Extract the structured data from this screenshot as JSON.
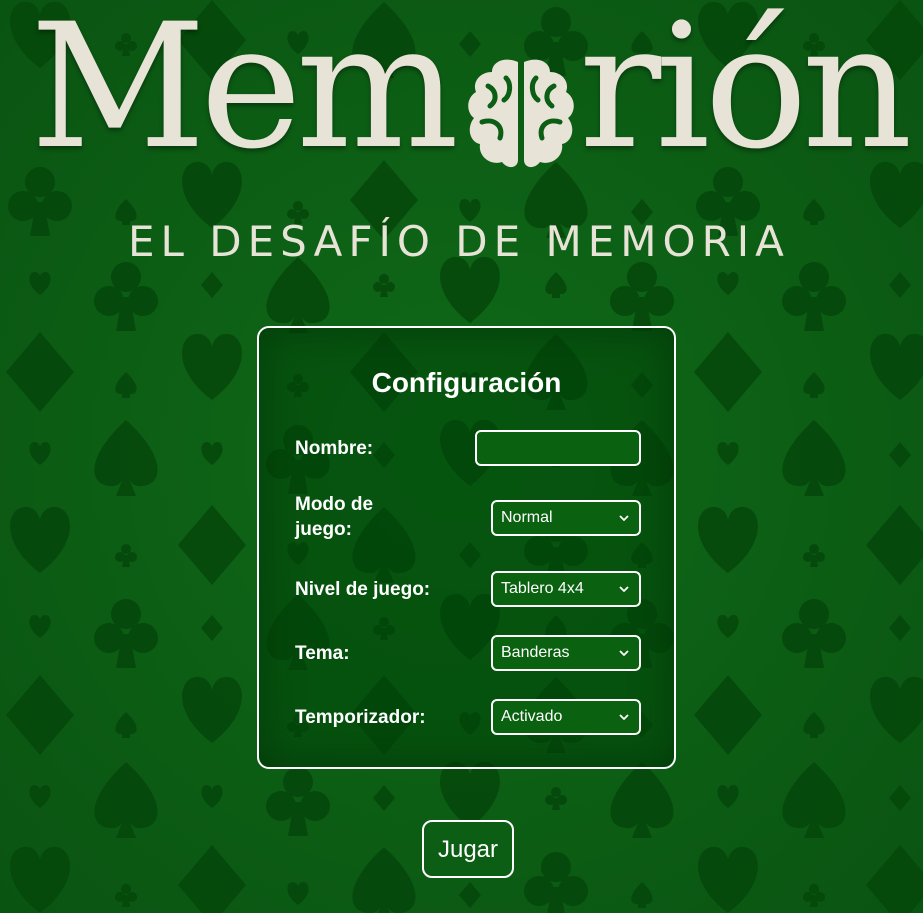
{
  "logo": {
    "title_part1": "Mem",
    "title_part2": "rión",
    "subtitle": "EL DESAFÍO DE MEMORIA"
  },
  "config": {
    "title": "Configuración",
    "name_label": "Nombre:",
    "name_value": "",
    "mode_label": "Modo de juego:",
    "mode_value": "Normal",
    "level_label": "Nivel de juego:",
    "level_value": "Tablero 4x4",
    "theme_label": "Tema:",
    "theme_value": "Banderas",
    "timer_label": "Temporizador:",
    "timer_value": "Activado"
  },
  "play_button": "Jugar",
  "colors": {
    "background": "#0b5e14",
    "pattern": "#054a0c",
    "logo_text": "#e7e3d6",
    "panel_border": "#ffffff"
  },
  "icons": {
    "brain": "brain-icon",
    "select_arrow": "chevron-down-icon",
    "background_suits": [
      "heart",
      "diamond",
      "club",
      "spade"
    ]
  }
}
